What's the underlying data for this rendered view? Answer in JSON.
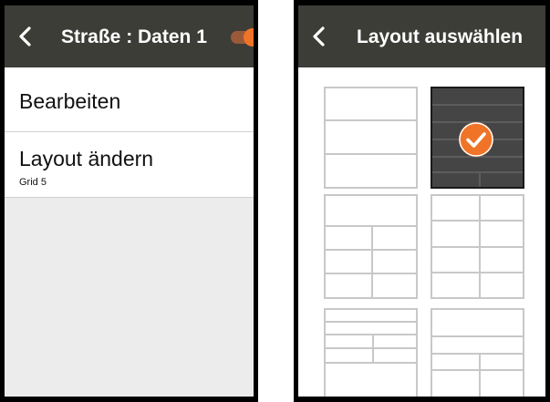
{
  "left": {
    "title": "Straße : Daten 1",
    "back_icon": "chevron-left-icon",
    "toggle": {
      "state": "on",
      "color": "#f07428"
    },
    "menu": [
      {
        "label": "Bearbeiten"
      },
      {
        "label": "Layout ändern",
        "sub": "Grid 5"
      }
    ]
  },
  "right": {
    "title": "Layout auswählen",
    "back_icon": "chevron-left-icon",
    "selected_layout_index": 1,
    "check_icon": "checkmark-circle-icon"
  },
  "colors": {
    "header": "#3d3d38",
    "accent": "#f07428",
    "background": "#ececec"
  }
}
